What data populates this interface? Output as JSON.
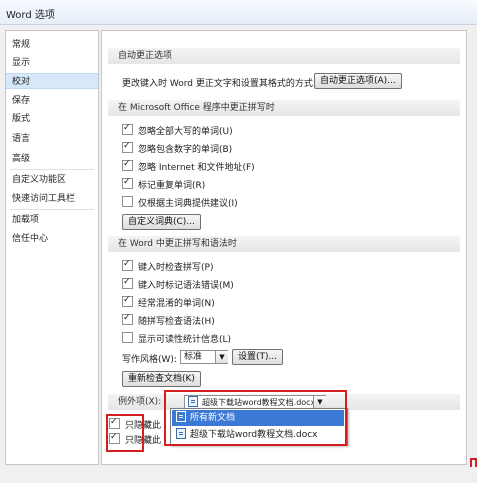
{
  "window": {
    "title": "Word 选项"
  },
  "nav": {
    "items": [
      {
        "label": "常规"
      },
      {
        "label": "显示"
      },
      {
        "label": "校对",
        "selected": true
      },
      {
        "label": "保存"
      },
      {
        "label": "版式"
      },
      {
        "label": "语言"
      },
      {
        "label": "高级"
      },
      {
        "label": "自定义功能区"
      },
      {
        "label": "快速访问工具栏"
      },
      {
        "label": "加载项"
      },
      {
        "label": "信任中心"
      }
    ]
  },
  "autocorrect": {
    "heading": "自动更正选项",
    "description": "更改键入时 Word 更正文字和设置其格式的方式:",
    "button": "自动更正选项(A)..."
  },
  "office_spelling": {
    "heading": "在 Microsoft Office 程序中更正拼写时",
    "options": [
      {
        "label": "忽略全部大写的单词(U)",
        "checked": true
      },
      {
        "label": "忽略包含数字的单词(B)",
        "checked": true
      },
      {
        "label": "忽略 Internet 和文件地址(F)",
        "checked": true
      },
      {
        "label": "标记重复单词(R)",
        "checked": true
      },
      {
        "label": "仅根据主词典提供建议(I)",
        "checked": false
      }
    ],
    "custom_dict_button": "自定义词典(C)..."
  },
  "word_spelling": {
    "heading": "在 Word 中更正拼写和语法时",
    "options": [
      {
        "label": "键入时检查拼写(P)",
        "checked": true
      },
      {
        "label": "键入时标记语法错误(M)",
        "checked": true
      },
      {
        "label": "经常混淆的单词(N)",
        "checked": true
      },
      {
        "label": "随拼写检查语法(H)",
        "checked": true
      },
      {
        "label": "显示可读性统计信息(L)",
        "checked": false
      }
    ],
    "writing_style_label": "写作风格(W):",
    "writing_style_value": "标准",
    "settings_button": "设置(T)...",
    "recheck_button": "重新检查文档(K)"
  },
  "exceptions": {
    "label": "例外项(X):",
    "selected_doc": "超级下载站word教程文档.docx",
    "dropdown_options": [
      {
        "label": "所有新文档",
        "highlighted": true
      },
      {
        "label": "超级下载站word教程文档.docx",
        "highlighted": false
      }
    ],
    "options": [
      {
        "label": "只隐藏此",
        "checked": true
      },
      {
        "label": "只隐藏此",
        "checked": true
      }
    ]
  },
  "colors": {
    "highlight": "#3b79d6",
    "selection": "#d6e8f9",
    "annotation": "#d41f1f"
  }
}
